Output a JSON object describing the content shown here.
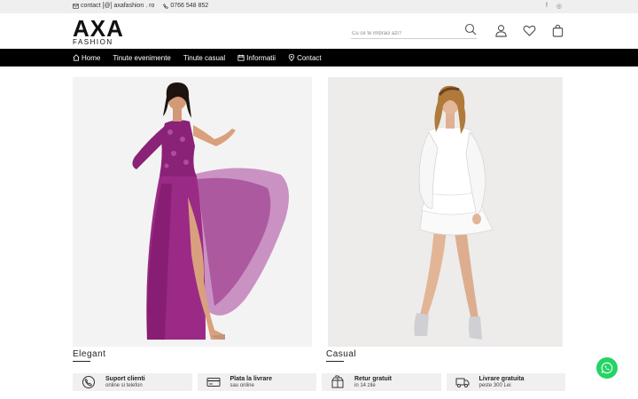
{
  "topbar": {
    "email": "contact [@] axafashion . ro",
    "phone": "0766 548 852",
    "social": [
      {
        "icon": "facebook-icon",
        "glyph": "f"
      },
      {
        "icon": "instagram-icon",
        "glyph": "◎"
      }
    ]
  },
  "header": {
    "logo_main": "AXA",
    "logo_sub": "FASHION",
    "search_placeholder": "Cu ce te imbraci azi?"
  },
  "nav": {
    "items": [
      {
        "label": "Home",
        "icon": "home-icon"
      },
      {
        "label": "Tinute evenimente"
      },
      {
        "label": "Tinute casual"
      },
      {
        "label": "Informatii",
        "icon": "calendar-icon"
      },
      {
        "label": "Contact",
        "icon": "location-pin-icon"
      }
    ]
  },
  "categories": [
    {
      "label": "Elegant"
    },
    {
      "label": "Casual"
    }
  ],
  "features": [
    {
      "title": "Suport clienti",
      "subtitle": "online si telefon",
      "icon": "phone-support-icon"
    },
    {
      "title": "Plata la livrare",
      "subtitle": "sau online",
      "icon": "credit-card-icon"
    },
    {
      "title": "Retur gratuit",
      "subtitle": "in 14 zile",
      "icon": "return-box-icon"
    },
    {
      "title": "Livrare gratuita",
      "subtitle": "peste 300 Lei",
      "icon": "delivery-truck-icon"
    }
  ],
  "colors": {
    "nav_bg": "#000000",
    "topbar_bg": "#efefef",
    "whatsapp": "#25d366",
    "dress_elegant": "#9b2a86"
  }
}
